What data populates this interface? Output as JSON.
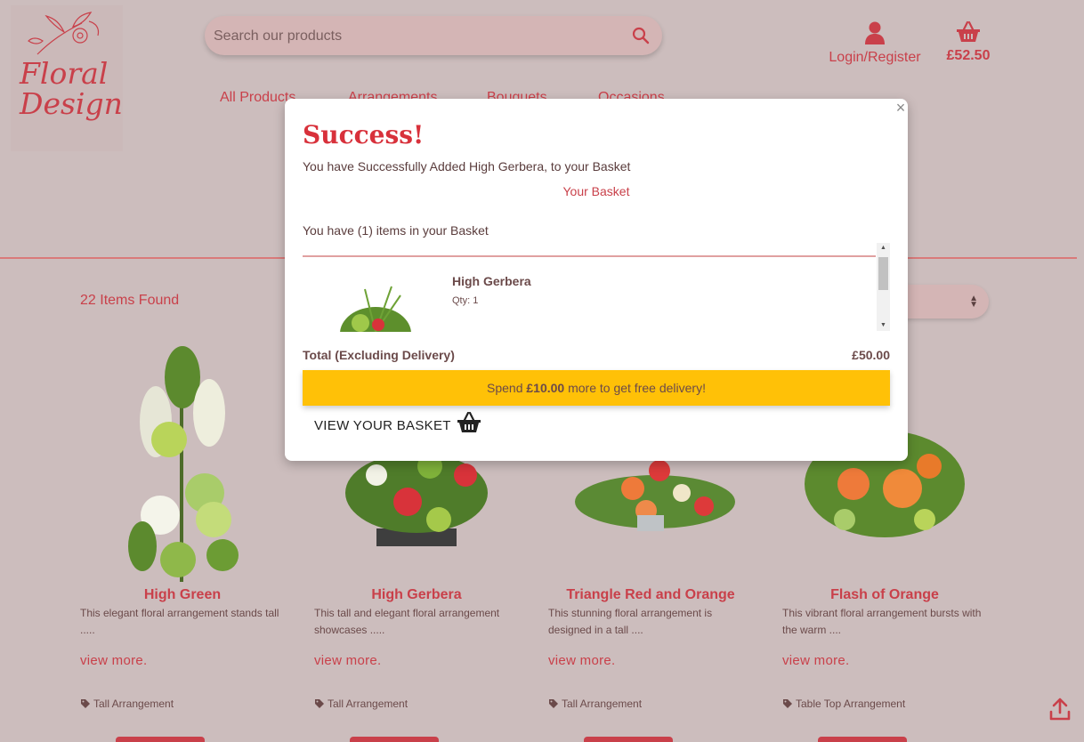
{
  "logo": {
    "text": "Floral Design"
  },
  "header": {
    "search_placeholder": "Search our products",
    "account_label": "Login/Register",
    "basket_total": "£52.50"
  },
  "nav": {
    "items": [
      "All Products",
      "Arrangements",
      "Bouquets",
      "Occasions"
    ]
  },
  "results": {
    "count_text": "22 Items Found"
  },
  "products": [
    {
      "name": "High Green",
      "desc": "This elegant floral arrangement stands tall .....",
      "more": "view more.",
      "tag": "Tall Arrangement"
    },
    {
      "name": "High Gerbera",
      "desc": "This tall and elegant floral arrangement showcases .....",
      "more": "view more.",
      "tag": "Tall Arrangement"
    },
    {
      "name": "Triangle Red and Orange",
      "desc": "This stunning floral arrangement is designed in a tall ....",
      "more": "view more.",
      "tag": "Tall Arrangement"
    },
    {
      "name": "Flash of Orange",
      "desc": "This vibrant floral arrangement bursts with the warm ....",
      "more": "view more.",
      "tag": "Table Top Arrangement"
    }
  ],
  "modal": {
    "close": "×",
    "heading": "Success!",
    "message": "You have Successfully Added High Gerbera, to your Basket",
    "basket_link": "Your Basket",
    "count_text": "You have (1) items in your Basket",
    "items": [
      {
        "name": "High Gerbera",
        "qty": "Qty: 1"
      }
    ],
    "total_label": "Total (Excluding Delivery)",
    "total_value": "£50.00",
    "delivery_prefix": "Spend ",
    "delivery_amount": "£10.00",
    "delivery_suffix": " more to get free delivery!",
    "view_basket": "VIEW YOUR BASKET"
  },
  "colors": {
    "accent": "#c9404a",
    "page_bg": "#ccbdbd",
    "banner": "#ffc107"
  }
}
